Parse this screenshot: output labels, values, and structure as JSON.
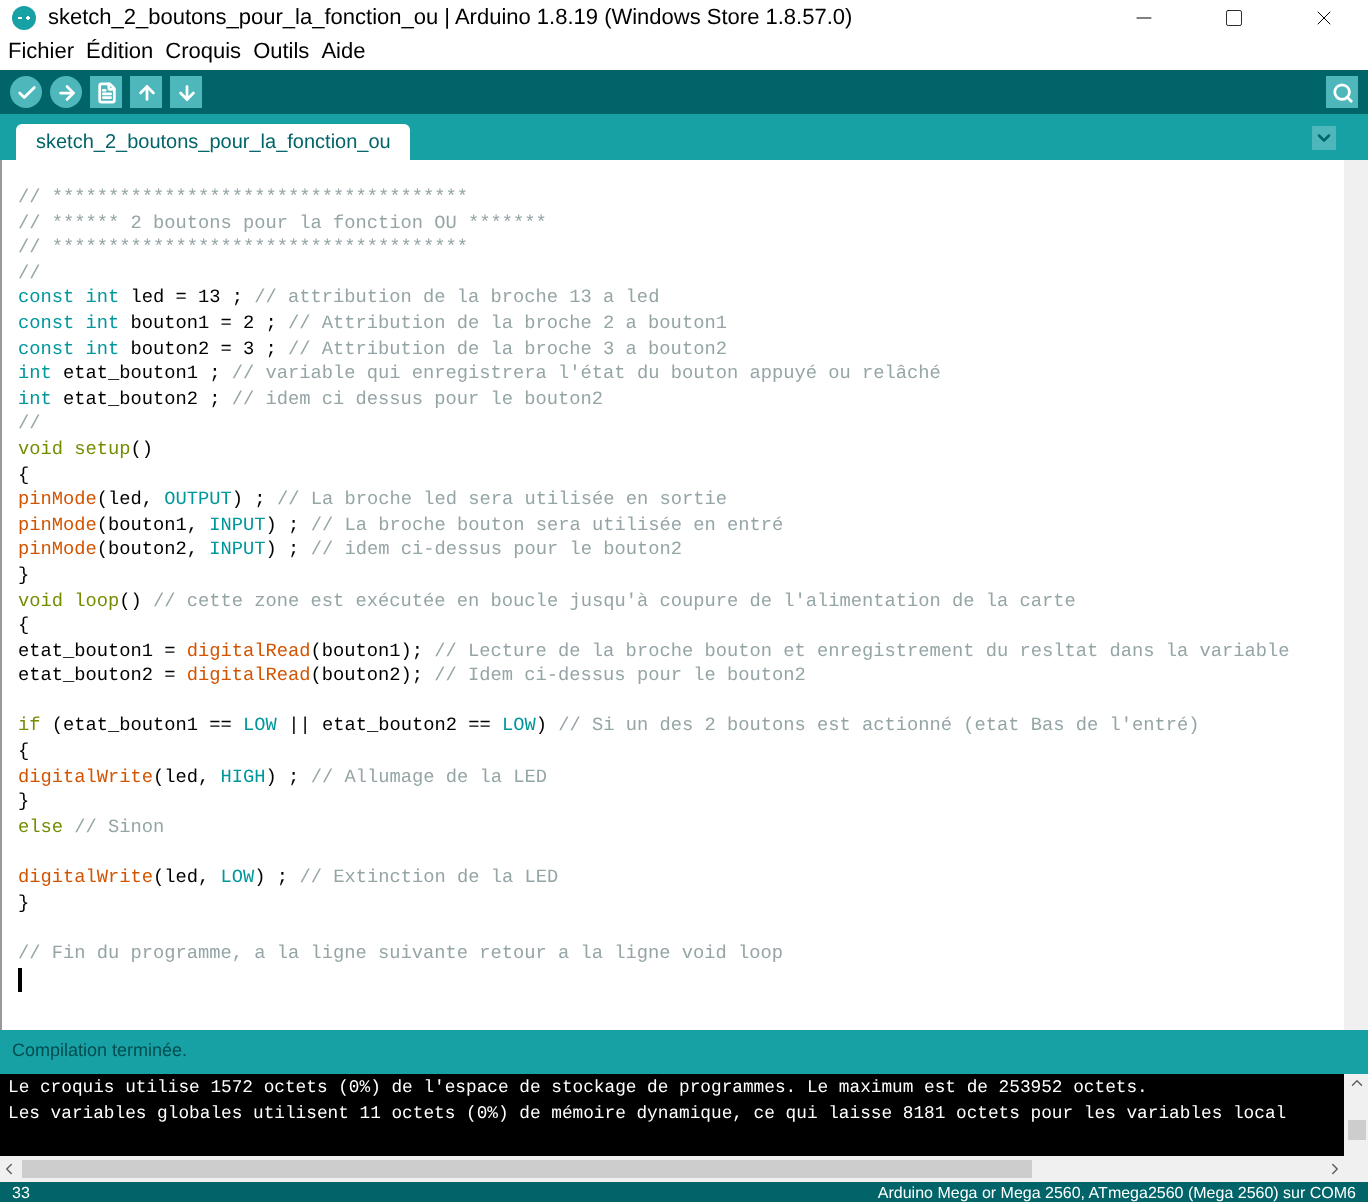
{
  "window": {
    "title": "sketch_2_boutons_pour_la_fonction_ou | Arduino 1.8.19 (Windows Store 1.8.57.0)"
  },
  "menu": [
    "Fichier",
    "Édition",
    "Croquis",
    "Outils",
    "Aide"
  ],
  "tabs": [
    {
      "label": "sketch_2_boutons_pour_la_fonction_ou",
      "selected": true
    }
  ],
  "editor": {
    "lines": [
      {
        "kind": "code",
        "tokens": [
          {
            "kind": "comment",
            "text": "// *************************************"
          }
        ]
      },
      {
        "kind": "code",
        "tokens": [
          {
            "kind": "comment",
            "text": "// ****** 2 boutons pour la fonction OU *******"
          }
        ]
      },
      {
        "kind": "code",
        "tokens": [
          {
            "kind": "comment",
            "text": "// *************************************"
          }
        ]
      },
      {
        "kind": "code",
        "tokens": [
          {
            "kind": "comment",
            "text": "//"
          }
        ]
      },
      {
        "kind": "code",
        "tokens": [
          {
            "kind": "type",
            "text": "const int"
          },
          {
            "kind": "plain",
            "text": " led = 13 ; "
          },
          {
            "kind": "comment",
            "text": "// attribution de la broche 13 a led"
          }
        ]
      },
      {
        "kind": "code",
        "tokens": [
          {
            "kind": "type",
            "text": "const int"
          },
          {
            "kind": "plain",
            "text": " bouton1 = 2 ; "
          },
          {
            "kind": "comment",
            "text": "// Attribution de la broche 2 a bouton1"
          }
        ]
      },
      {
        "kind": "code",
        "tokens": [
          {
            "kind": "type",
            "text": "const int"
          },
          {
            "kind": "plain",
            "text": " bouton2 = 3 ; "
          },
          {
            "kind": "comment",
            "text": "// Attribution de la broche 3 a bouton2"
          }
        ]
      },
      {
        "kind": "code",
        "tokens": [
          {
            "kind": "type",
            "text": "int"
          },
          {
            "kind": "plain",
            "text": " etat_bouton1 ; "
          },
          {
            "kind": "comment",
            "text": "// variable qui enregistrera l'état du bouton appuyé ou relâché"
          }
        ]
      },
      {
        "kind": "code",
        "tokens": [
          {
            "kind": "type",
            "text": "int"
          },
          {
            "kind": "plain",
            "text": " etat_bouton2 ; "
          },
          {
            "kind": "comment",
            "text": "// idem ci dessus pour le bouton2"
          }
        ]
      },
      {
        "kind": "code",
        "tokens": [
          {
            "kind": "comment",
            "text": "//"
          }
        ]
      },
      {
        "kind": "code",
        "tokens": [
          {
            "kind": "keyword",
            "text": "void setup"
          },
          {
            "kind": "plain",
            "text": "()"
          }
        ]
      },
      {
        "kind": "code",
        "tokens": [
          {
            "kind": "plain",
            "text": "{"
          }
        ]
      },
      {
        "kind": "code",
        "tokens": [
          {
            "kind": "function",
            "text": "pinMode"
          },
          {
            "kind": "plain",
            "text": "(led, "
          },
          {
            "kind": "constant",
            "text": "OUTPUT"
          },
          {
            "kind": "plain",
            "text": ") ; "
          },
          {
            "kind": "comment",
            "text": "// La broche led sera utilisée en sortie"
          }
        ]
      },
      {
        "kind": "code",
        "tokens": [
          {
            "kind": "function",
            "text": "pinMode"
          },
          {
            "kind": "plain",
            "text": "(bouton1, "
          },
          {
            "kind": "constant",
            "text": "INPUT"
          },
          {
            "kind": "plain",
            "text": ") ; "
          },
          {
            "kind": "comment",
            "text": "// La broche bouton sera utilisée en entré"
          }
        ]
      },
      {
        "kind": "code",
        "tokens": [
          {
            "kind": "function",
            "text": "pinMode"
          },
          {
            "kind": "plain",
            "text": "(bouton2, "
          },
          {
            "kind": "constant",
            "text": "INPUT"
          },
          {
            "kind": "plain",
            "text": ") ; "
          },
          {
            "kind": "comment",
            "text": "// idem ci-dessus pour le bouton2"
          }
        ]
      },
      {
        "kind": "code",
        "tokens": [
          {
            "kind": "plain",
            "text": "}"
          }
        ]
      },
      {
        "kind": "code",
        "tokens": [
          {
            "kind": "keyword",
            "text": "void loop"
          },
          {
            "kind": "plain",
            "text": "() "
          },
          {
            "kind": "comment",
            "text": "// cette zone est exécutée en boucle jusqu'à coupure de l'alimentation de la carte"
          }
        ]
      },
      {
        "kind": "code",
        "tokens": [
          {
            "kind": "plain",
            "text": "{"
          }
        ]
      },
      {
        "kind": "code",
        "tokens": [
          {
            "kind": "plain",
            "text": "etat_bouton1 = "
          },
          {
            "kind": "function",
            "text": "digitalRead"
          },
          {
            "kind": "plain",
            "text": "(bouton1); "
          },
          {
            "kind": "comment",
            "text": "// Lecture de la broche bouton et enregistrement du resltat dans la variable"
          }
        ]
      },
      {
        "kind": "code",
        "tokens": [
          {
            "kind": "plain",
            "text": "etat_bouton2 = "
          },
          {
            "kind": "function",
            "text": "digitalRead"
          },
          {
            "kind": "plain",
            "text": "(bouton2); "
          },
          {
            "kind": "comment",
            "text": "// Idem ci-dessus pour le bouton2"
          }
        ]
      },
      {
        "kind": "blank"
      },
      {
        "kind": "code",
        "tokens": [
          {
            "kind": "keyword",
            "text": "if"
          },
          {
            "kind": "plain",
            "text": " (etat_bouton1 == "
          },
          {
            "kind": "constant",
            "text": "LOW"
          },
          {
            "kind": "plain",
            "text": " || etat_bouton2 == "
          },
          {
            "kind": "constant",
            "text": "LOW"
          },
          {
            "kind": "plain",
            "text": ") "
          },
          {
            "kind": "comment",
            "text": "// Si un des 2 boutons est actionné (etat Bas de l'entré)"
          }
        ]
      },
      {
        "kind": "code",
        "tokens": [
          {
            "kind": "plain",
            "text": "{"
          }
        ]
      },
      {
        "kind": "code",
        "tokens": [
          {
            "kind": "function",
            "text": "digitalWrite"
          },
          {
            "kind": "plain",
            "text": "(led, "
          },
          {
            "kind": "constant",
            "text": "HIGH"
          },
          {
            "kind": "plain",
            "text": ") ; "
          },
          {
            "kind": "comment",
            "text": "// Allumage de la LED"
          }
        ]
      },
      {
        "kind": "code",
        "tokens": [
          {
            "kind": "plain",
            "text": "}"
          }
        ]
      },
      {
        "kind": "code",
        "tokens": [
          {
            "kind": "keyword",
            "text": "else"
          },
          {
            "kind": "comment",
            "text": " // Sinon"
          }
        ]
      },
      {
        "kind": "blank"
      },
      {
        "kind": "code",
        "tokens": [
          {
            "kind": "function",
            "text": "digitalWrite"
          },
          {
            "kind": "plain",
            "text": "(led, "
          },
          {
            "kind": "constant",
            "text": "LOW"
          },
          {
            "kind": "plain",
            "text": ") ; "
          },
          {
            "kind": "comment",
            "text": "// Extinction de la LED"
          }
        ]
      },
      {
        "kind": "code",
        "tokens": [
          {
            "kind": "plain",
            "text": "}"
          }
        ]
      },
      {
        "kind": "blank"
      },
      {
        "kind": "code",
        "tokens": [
          {
            "kind": "comment",
            "text": "// Fin du programme, a la ligne suivante retour a la ligne void loop"
          }
        ]
      },
      {
        "kind": "cursor"
      }
    ]
  },
  "message": "Compilation terminée.",
  "console": [
    "Le croquis utilise 1572 octets (0%) de l'espace de stockage de programmes. Le maximum est de 253952 octets.",
    "Les variables globales utilisent 11 octets (0%) de mémoire dynamique, ce qui laisse 8181 octets pour les variables local"
  ],
  "status_bar": {
    "line": "33",
    "board": "Arduino Mega or Mega 2560, ATmega2560 (Mega 2560) sur COM6"
  }
}
